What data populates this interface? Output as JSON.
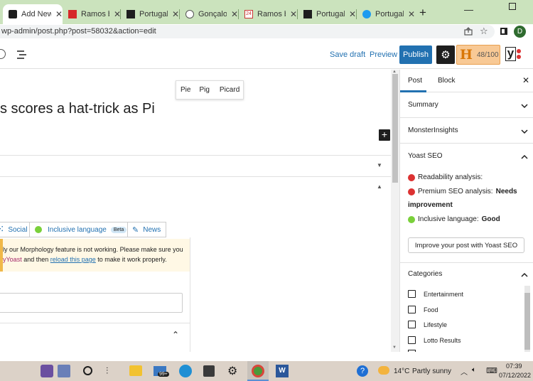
{
  "browser": {
    "tabs": [
      {
        "title": "Add New",
        "active": true,
        "icon": "wordpress-icon"
      },
      {
        "title": "Ramos ba",
        "active": false,
        "icon": "red-e-icon"
      },
      {
        "title": "Portugal",
        "active": false,
        "icon": "black-a-icon"
      },
      {
        "title": "Gonçalo R",
        "active": false,
        "icon": "pin-icon"
      },
      {
        "title": "Ramos ba",
        "active": false,
        "icon": "24-icon"
      },
      {
        "title": "Portugal",
        "active": false,
        "icon": "black-e-icon"
      },
      {
        "title": "Portugal",
        "active": false,
        "icon": "twitter-icon"
      }
    ],
    "new_tab": "+",
    "url": "wp-admin/post.php?post=58032&action=edit",
    "profile_initial": "D"
  },
  "toolbar": {
    "save_draft": "Save draft",
    "preview": "Preview",
    "publish": "Publish",
    "headline_score": "48/100",
    "headline_letter": "H",
    "yoast_letter": "y"
  },
  "editor": {
    "autocomplete": [
      "Pie",
      "Pig",
      "Picard"
    ],
    "title_fragment": "s scores a hat-trick as Pi",
    "yoast_tabs": {
      "social": "Social",
      "inclusive": "Inclusive language",
      "beta": "Beta",
      "news": "News"
    },
    "notice_line1": "ly our Morphology feature is not working. Please make sure you",
    "notice_line2_prefix": "yYoast",
    "notice_line2_mid": " and then ",
    "notice_link": "reload this page",
    "notice_line2_suffix": " to make it work properly."
  },
  "sidebar": {
    "tabs": {
      "post": "Post",
      "block": "Block"
    },
    "sections": {
      "summary": "Summary",
      "monsterinsights": "MonsterInsights",
      "yoast": "Yoast SEO",
      "categories": "Categories"
    },
    "yoast": {
      "readability": "Readability analysis:",
      "seo_label": "Premium SEO analysis:",
      "seo_value": "Needs",
      "seo_value2": "improvement",
      "inclusive_label": "Inclusive language:",
      "inclusive_value": "Good",
      "improve_button": "Improve your post with Yoast SEO"
    },
    "categories": [
      "Entertainment",
      "Food",
      "Lifestyle",
      "Lotto Results"
    ]
  },
  "taskbar": {
    "badge": "99+",
    "weather_temp": "14°C",
    "weather_text": "Partly sunny",
    "time": "07:39",
    "date": "07/12/2022"
  },
  "colors": {
    "wp_blue": "#2271b1",
    "tab_strip": "#cbe3bd",
    "notice_bg": "#fff8e5",
    "yoast_red": "#dc3232",
    "yoast_green": "#7ad03a",
    "hscore_bg": "#f8c995"
  }
}
